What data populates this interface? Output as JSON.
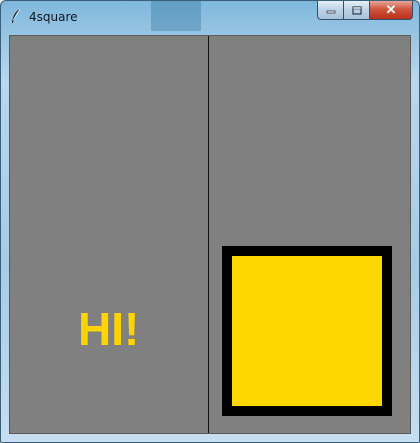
{
  "window": {
    "title": "4square",
    "app_icon": "feather-icon",
    "close_glyph": "✕"
  },
  "caption_buttons": {
    "minimize_icon": "minimize-icon",
    "maximize_icon": "maximize-icon",
    "close_icon": "close-icon"
  },
  "canvas": {
    "background_color": "#808080",
    "divider_color": "#111111",
    "greeting_text": "HI!",
    "greeting_color": "#ffd400",
    "square_fill": "#ffd700",
    "square_border": "#000000"
  }
}
